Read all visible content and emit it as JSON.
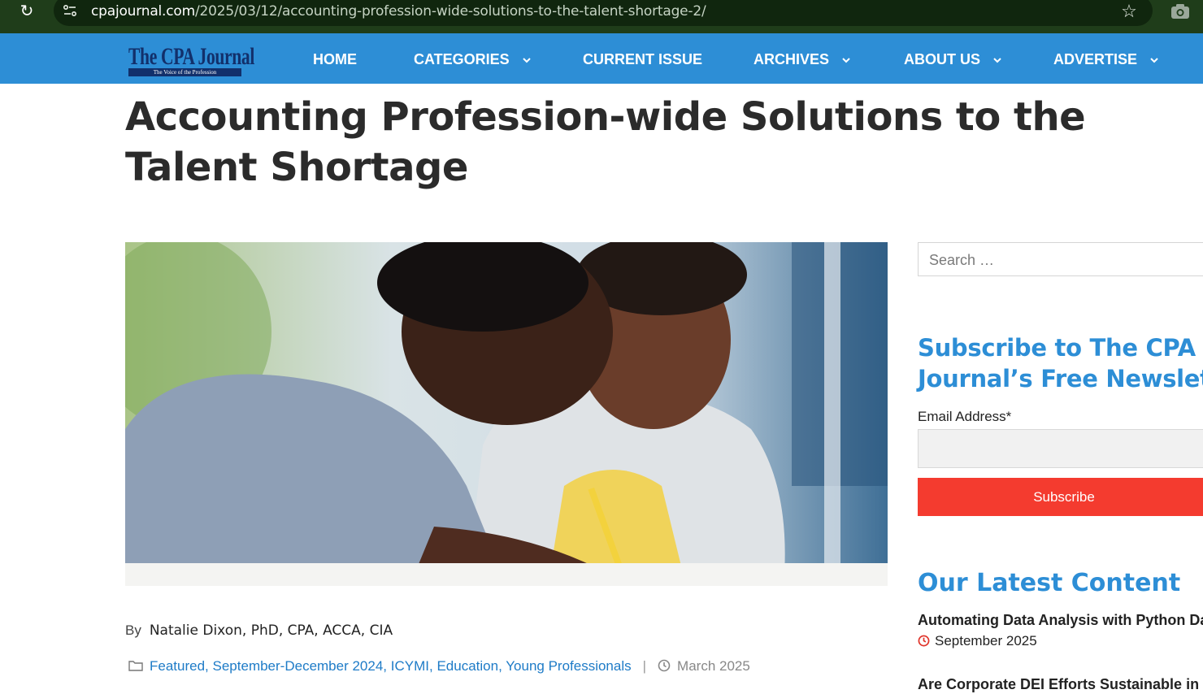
{
  "browser": {
    "url_host": "cpajournal.com",
    "url_path": "/2025/03/12/accounting-profession-wide-solutions-to-the-talent-shortage-2/",
    "icons": [
      "reload-icon",
      "site-info-icon",
      "bookmark-star-icon",
      "screenshot-camera-icon"
    ]
  },
  "header": {
    "logo_title": "The CPA Journal",
    "logo_subtitle": "The Voice of the Profession",
    "nav": [
      {
        "label": "HOME"
      },
      {
        "label": "CATEGORIES"
      },
      {
        "label": "CURRENT ISSUE"
      },
      {
        "label": "ARCHIVES"
      },
      {
        "label": "ABOUT US"
      },
      {
        "label": "ADVERTISE"
      }
    ],
    "bar_color": "#2d8ed6"
  },
  "article": {
    "title": "Accounting Profession-wide Solutions to the Talent Shortage",
    "by_label": "By",
    "author": "Natalie Dixon, PhD, CPA, ACCA, CIA",
    "categories": [
      "Featured",
      "September-December 2024",
      "ICYMI",
      "Education",
      "Young Professionals"
    ],
    "separator": "|",
    "date": "March 2025"
  },
  "sidebar": {
    "search_placeholder": "Search …",
    "subscribe_heading": "Subscribe to The CPA Journal’s Free Newslett",
    "email_label": "Email Address*",
    "subscribe_button": "Subscribe",
    "latest_heading": "Our Latest Content",
    "latest_item_title": "Automating Data Analysis with Python Da",
    "latest_item_date": "September 2025",
    "next_item_title": "Are Corporate DEI Efforts Sustainable in T"
  },
  "colors": {
    "accent": "#2d8ed6",
    "button": "#f43b2f",
    "link": "#1e7bc7"
  }
}
